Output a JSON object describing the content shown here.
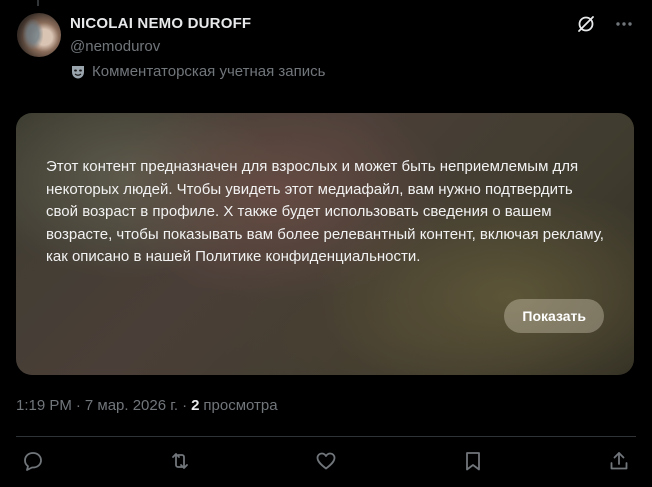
{
  "author": {
    "display_name": "NICOLAI NEMO DUROFF",
    "handle": "@nemodurov",
    "account_label": "Комментаторская учетная запись"
  },
  "media": {
    "warning_text": "Этот контент предназначен для взрослых и может быть неприемлемым для некоторых людей. Чтобы увидеть этот медиафайл, вам нужно подтвердить свой возраст в профиле. X также будет использовать сведения о вашем возрасте, чтобы показывать вам более релевантный контент, включая рекламу, как описано в нашей Политике конфиденциальности.",
    "show_button_label": "Показать"
  },
  "meta": {
    "time": "1:19 PM",
    "separator1": "·",
    "date": "7 мар. 2026 г.",
    "separator2": "·",
    "views_count": "2",
    "views_label": "просмотра"
  },
  "icons": {
    "top": [
      "grok-icon",
      "more-icon"
    ],
    "actions": [
      "reply-icon",
      "repost-icon",
      "like-icon",
      "bookmark-icon",
      "share-icon"
    ]
  },
  "colors": {
    "background": "#000000",
    "primary_text": "#e7e9ea",
    "secondary_text": "#71767b",
    "divider": "#2f3336"
  }
}
